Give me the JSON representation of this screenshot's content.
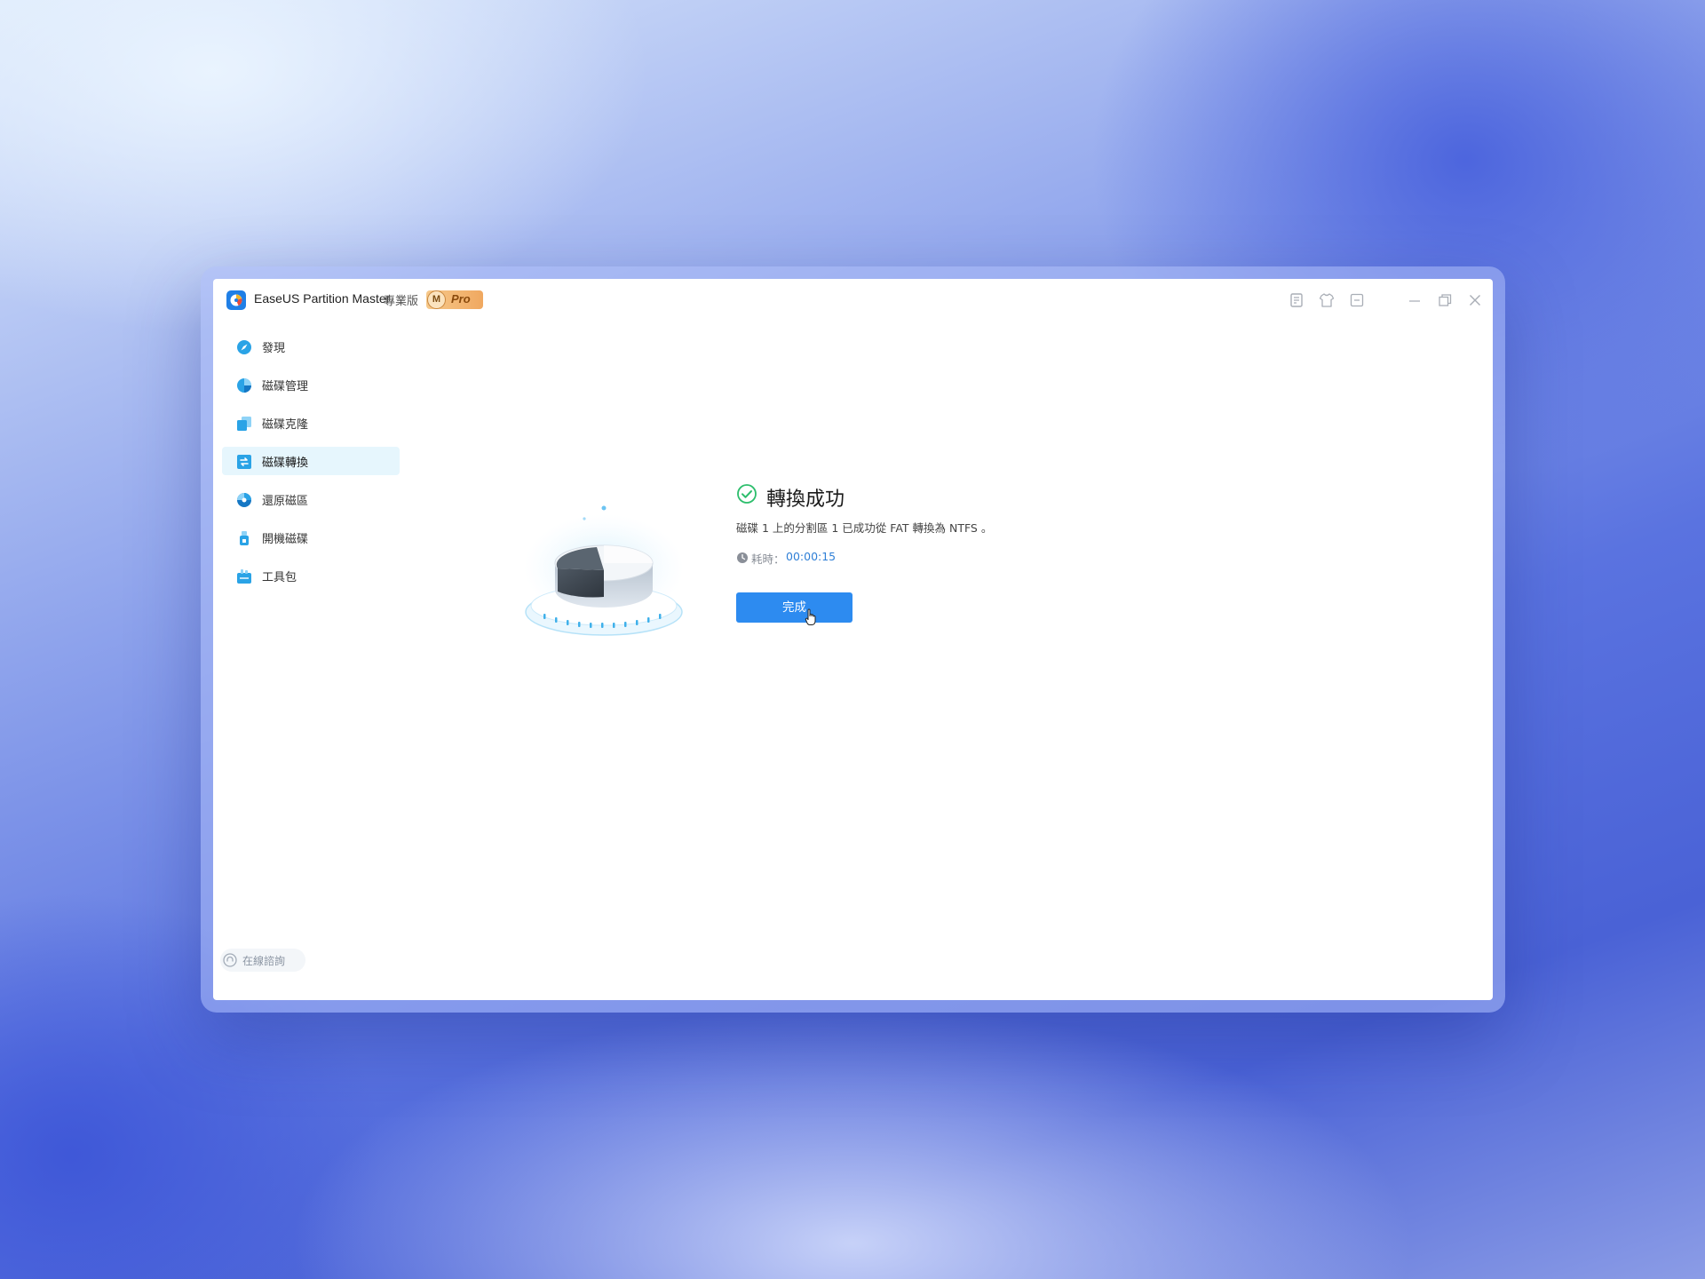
{
  "app": {
    "title": "EaseUS Partition Master",
    "edition": "專業版",
    "badge_letter": "M",
    "badge_label": "Pro"
  },
  "titlebar_icons": [
    "feedback-icon",
    "theme-shirt-icon",
    "collapse-icon",
    "minimize-icon",
    "restore-icon",
    "close-icon"
  ],
  "sidebar": {
    "items": [
      {
        "label": "發現",
        "icon": "discover-icon",
        "active": false
      },
      {
        "label": "磁碟管理",
        "icon": "disk-management-icon",
        "active": false
      },
      {
        "label": "磁碟克隆",
        "icon": "disk-clone-icon",
        "active": false
      },
      {
        "label": "磁碟轉換",
        "icon": "disk-convert-icon",
        "active": true
      },
      {
        "label": "還原磁區",
        "icon": "partition-recovery-icon",
        "active": false
      },
      {
        "label": "開機磁碟",
        "icon": "bootable-disk-icon",
        "active": false
      },
      {
        "label": "工具包",
        "icon": "toolkit-icon",
        "active": false
      }
    ],
    "consult_label": "在線諮詢"
  },
  "result": {
    "title": "轉換成功",
    "description": "磁碟 1 上的分割區 1 已成功從 FAT 轉換為 NTFS 。",
    "elapsed_label": "耗時：",
    "elapsed_value": "00:00:15",
    "done_label": "完成"
  },
  "colors": {
    "accent": "#2d8bf0",
    "success": "#2dbe6c",
    "active_bg": "#e6f6fd",
    "icon_blue": "#2aa3e6"
  }
}
